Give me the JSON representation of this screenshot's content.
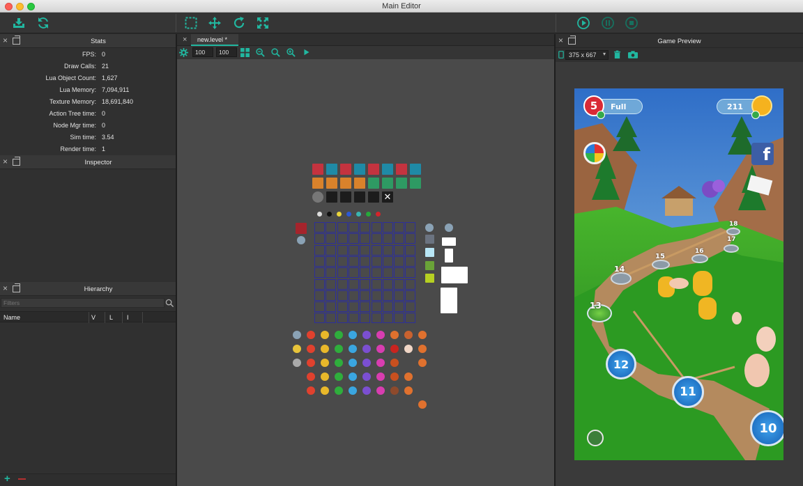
{
  "window": {
    "title": "Main Editor"
  },
  "colors": {
    "accent": "#21b7a0",
    "panel": "#303030",
    "canvas": "#4a4a4a",
    "grid": "#2d2f9a"
  },
  "toolbar": {
    "left": [
      "import-icon",
      "refresh-icon"
    ],
    "center": [
      "select-icon",
      "move-icon",
      "rotate-icon",
      "scale-icon"
    ],
    "right": [
      "play-icon",
      "pause-icon",
      "stop-icon"
    ]
  },
  "stats": {
    "title": "Stats",
    "rows": [
      {
        "label": "FPS:",
        "value": "0"
      },
      {
        "label": "Draw Calls:",
        "value": "21"
      },
      {
        "label": "Lua Object Count:",
        "value": "1,627"
      },
      {
        "label": "Lua Memory:",
        "value": "7,094,911"
      },
      {
        "label": "Texture Memory:",
        "value": "18,691,840"
      },
      {
        "label": "Action Tree time:",
        "value": "0"
      },
      {
        "label": "Node Mgr time:",
        "value": "0"
      },
      {
        "label": "Sim time:",
        "value": "3.54"
      },
      {
        "label": "Render time:",
        "value": "1"
      }
    ]
  },
  "inspector": {
    "title": "Inspector"
  },
  "hierarchy": {
    "title": "Hierarchy",
    "filter_placeholder": "Filters",
    "columns": [
      "Name",
      "V",
      "L",
      "I"
    ]
  },
  "editor": {
    "tab": "new.level *",
    "width": "100",
    "height": "100"
  },
  "preview": {
    "title": "Game Preview",
    "resolution": "375 x 667",
    "hud": {
      "lives": "5",
      "lives_status": "Full",
      "coins": "211"
    },
    "levels": [
      "10",
      "11",
      "12",
      "13",
      "14",
      "15",
      "16",
      "17",
      "18"
    ]
  }
}
